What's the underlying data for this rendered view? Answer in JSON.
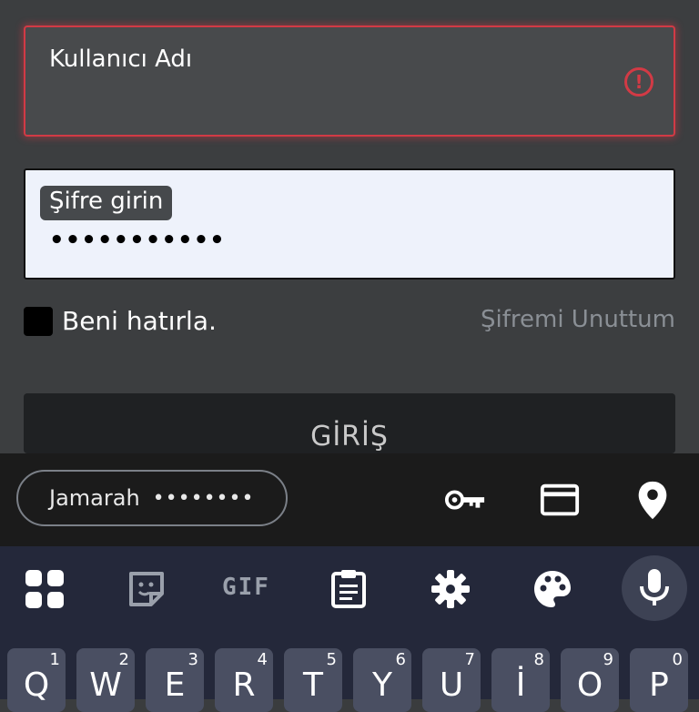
{
  "form": {
    "username_label": "Kullanıcı Adı",
    "error_icon": "!",
    "password_label": "Şifre girin",
    "password_value": "•••••••••••",
    "remember_label": "Beni hatırla.",
    "forgot_label": "Şifremi Unuttum",
    "login_label": "GİRİŞ"
  },
  "autofill": {
    "account_name": "Jamarah",
    "account_password": "••••••••",
    "icons": [
      "key-icon",
      "credit-card-icon",
      "location-pin-icon"
    ]
  },
  "toolbar": {
    "icons": [
      "apps-grid-icon",
      "sticker-icon",
      "gif-icon",
      "clipboard-icon",
      "settings-icon",
      "palette-icon",
      "microphone-icon"
    ],
    "gif_label": "GIF"
  },
  "keyboard": {
    "row1": [
      {
        "ch": "Q",
        "num": "1"
      },
      {
        "ch": "W",
        "num": "2"
      },
      {
        "ch": "E",
        "num": "3"
      },
      {
        "ch": "R",
        "num": "4"
      },
      {
        "ch": "T",
        "num": "5"
      },
      {
        "ch": "Y",
        "num": "6"
      },
      {
        "ch": "U",
        "num": "7"
      },
      {
        "ch": "İ",
        "num": "8"
      },
      {
        "ch": "O",
        "num": "9"
      },
      {
        "ch": "P",
        "num": "0"
      }
    ]
  },
  "colors": {
    "error": "#d23a45",
    "accent_field_bg": "#eef2fb",
    "keyboard_bg": "#24283a",
    "key_bg": "#4a4f62"
  }
}
